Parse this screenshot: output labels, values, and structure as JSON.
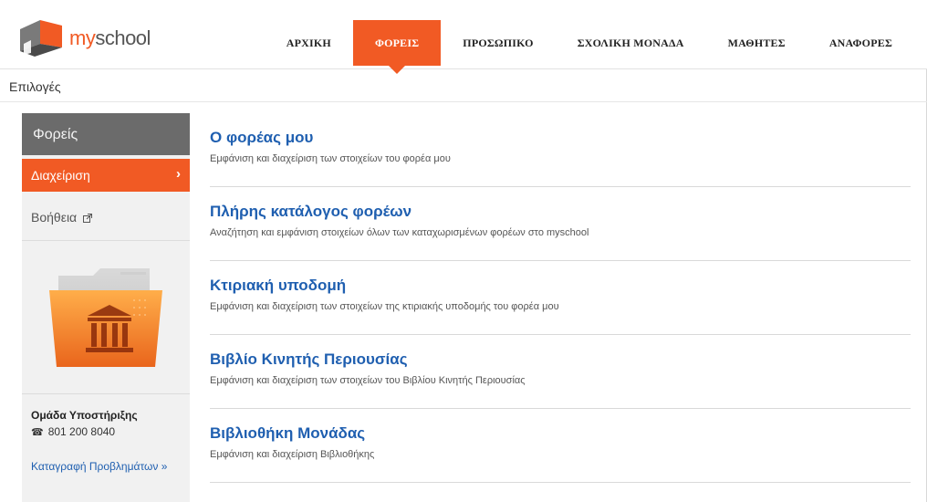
{
  "app": {
    "logo_text": "myschool",
    "logo_my": "my",
    "logo_school": "school"
  },
  "nav": {
    "items": [
      {
        "label": "ΑΡΧΙΚΗ"
      },
      {
        "label": "ΦΟΡΕΙΣ",
        "active": true
      },
      {
        "label": "ΠΡΟΣΩΠΙΚΟ"
      },
      {
        "label": "ΣΧΟΛΙΚΗ ΜΟΝΑΔΑ"
      },
      {
        "label": "ΜΑΘΗΤΕΣ"
      },
      {
        "label": "ΑΝΑΦΟΡΕΣ"
      }
    ]
  },
  "options_label": "Επιλογές",
  "sidebar": {
    "title": "Φορείς",
    "active_item": "Διαχείριση",
    "help_item": "Βοήθεια",
    "support_title": "Ομάδα Υποστήριξης",
    "support_phone": "801 200 8040",
    "support_link": "Καταγραφή Προβλημάτων »"
  },
  "main": {
    "items": [
      {
        "title": "Ο φορέας μου",
        "desc": "Εμφάνιση και διαχείριση των στοιχείων του φορέα μου"
      },
      {
        "title": "Πλήρης κατάλογος φορέων",
        "desc": "Αναζήτηση και εμφάνιση στοιχείων όλων των καταχωρισμένων φορέων στο myschool"
      },
      {
        "title": "Κτιριακή υποδομή",
        "desc": "Εμφάνιση και διαχείριση των στοιχείων της κτιριακής υποδομής του φορέα μου"
      },
      {
        "title": "Βιβλίο Κινητής Περιουσίας",
        "desc": "Εμφάνιση και διαχείριση των στοιχείων του Βιβλίου Κινητής Περιουσίας"
      },
      {
        "title": "Βιβλιοθήκη Μονάδας",
        "desc": "Εμφάνιση και διαχείριση Βιβλιοθήκης"
      }
    ]
  },
  "colors": {
    "accent": "#f15a24",
    "link": "#1f5fb0",
    "sidebar_header": "#6b6b6b",
    "sidebar_bg": "#f1f1f1"
  },
  "icons": {
    "logo": "myschool-logo-icon",
    "chevron": "chevron-right-icon",
    "external": "external-link-icon",
    "phone": "phone-icon",
    "folder": "institution-folder-icon"
  }
}
